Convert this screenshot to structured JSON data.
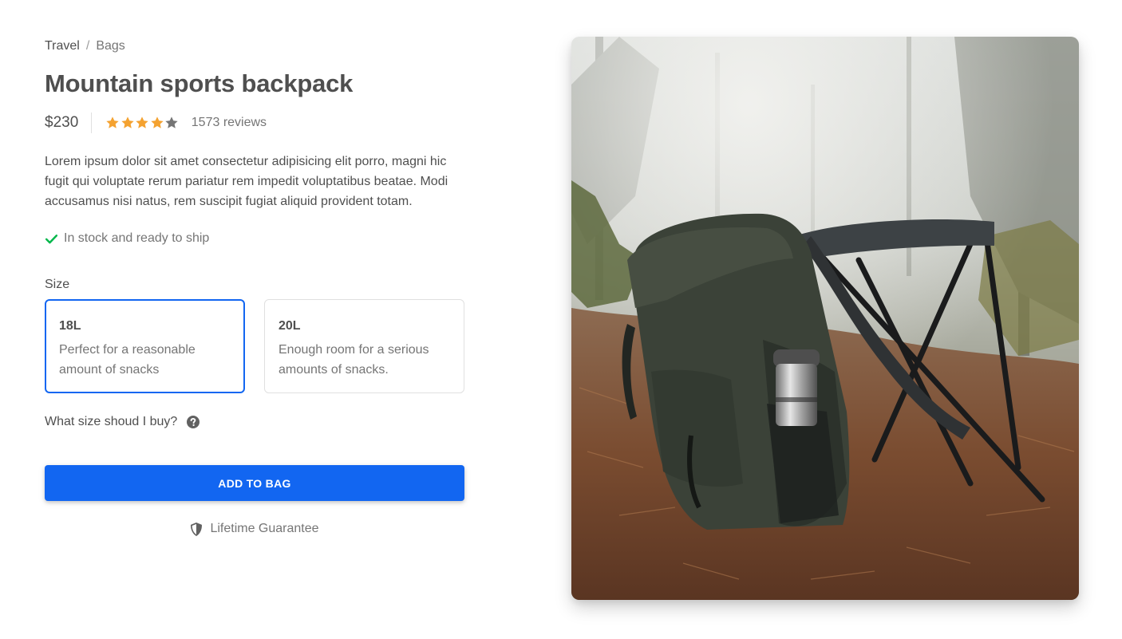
{
  "breadcrumb": {
    "items": [
      "Travel",
      "Bags"
    ],
    "separator": "/"
  },
  "product": {
    "title": "Mountain sports backpack",
    "price": "$230",
    "rating": 4,
    "rating_max": 5,
    "reviews": "1573 reviews",
    "description": "Lorem ipsum dolor sit amet consectetur adipisicing elit porro, magni hic fugit qui voluptate rerum pariatur rem impedit voluptatibus beatae. Modi accusamus nisi natus, rem suscipit fugiat aliquid provident totam.",
    "stock": "In stock and ready to ship"
  },
  "size": {
    "label": "Size",
    "options": [
      {
        "name": "18L",
        "info": "Perfect for a reasonable amount of snacks",
        "selected": true
      },
      {
        "name": "20L",
        "info": "Enough room for a serious amounts of snacks.",
        "selected": false
      }
    ],
    "help": "What size shoud I buy?"
  },
  "actions": {
    "add_to_bag": "ADD TO BAG"
  },
  "guarantee": "Lifetime Guarantee",
  "colors": {
    "accent": "#1266f1",
    "star_filled": "#f4a230",
    "star_empty": "#757575",
    "check": "#00b74a",
    "text": "#4f4f4f",
    "muted": "#757575"
  },
  "icons": {
    "star": "star-icon",
    "stock": "check-icon",
    "help": "question-circle-icon",
    "guarantee": "shield-icon"
  }
}
